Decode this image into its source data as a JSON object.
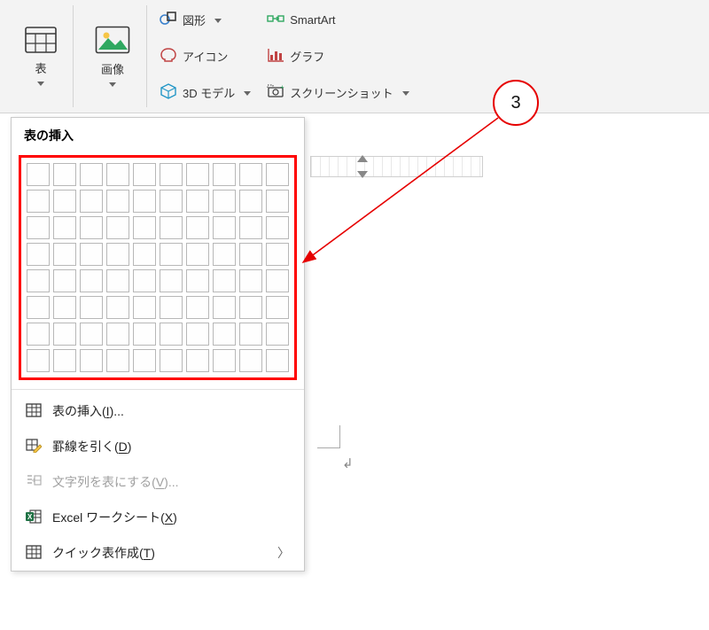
{
  "ribbon": {
    "table": {
      "label": "表"
    },
    "image": {
      "label": "画像"
    },
    "shapes": {
      "label": "図形"
    },
    "icons": {
      "label": "アイコン"
    },
    "model3d": {
      "label": "3D モデル"
    },
    "smartart": {
      "label": "SmartArt"
    },
    "chart": {
      "label": "グラフ"
    },
    "screenshot": {
      "label": "スクリーンショット"
    }
  },
  "dropdown": {
    "header": "表の挿入",
    "grid": {
      "cols": 10,
      "rows": 8
    },
    "items": {
      "insert_table": {
        "label_pre": "表の挿入(",
        "hotkey": "I",
        "label_post": ")..."
      },
      "draw_table": {
        "label_pre": "罫線を引く(",
        "hotkey": "D",
        "label_post": ")"
      },
      "text_to_table": {
        "label_pre": "文字列を表にする(",
        "hotkey": "V",
        "label_post": ")...",
        "disabled": true
      },
      "excel": {
        "label_pre": "Excel ワークシート(",
        "hotkey": "X",
        "label_post": ")"
      },
      "quick": {
        "label_pre": "クイック表作成(",
        "hotkey": "T",
        "label_post": ")",
        "submenu": true
      }
    }
  },
  "annotation": {
    "label": "3"
  }
}
